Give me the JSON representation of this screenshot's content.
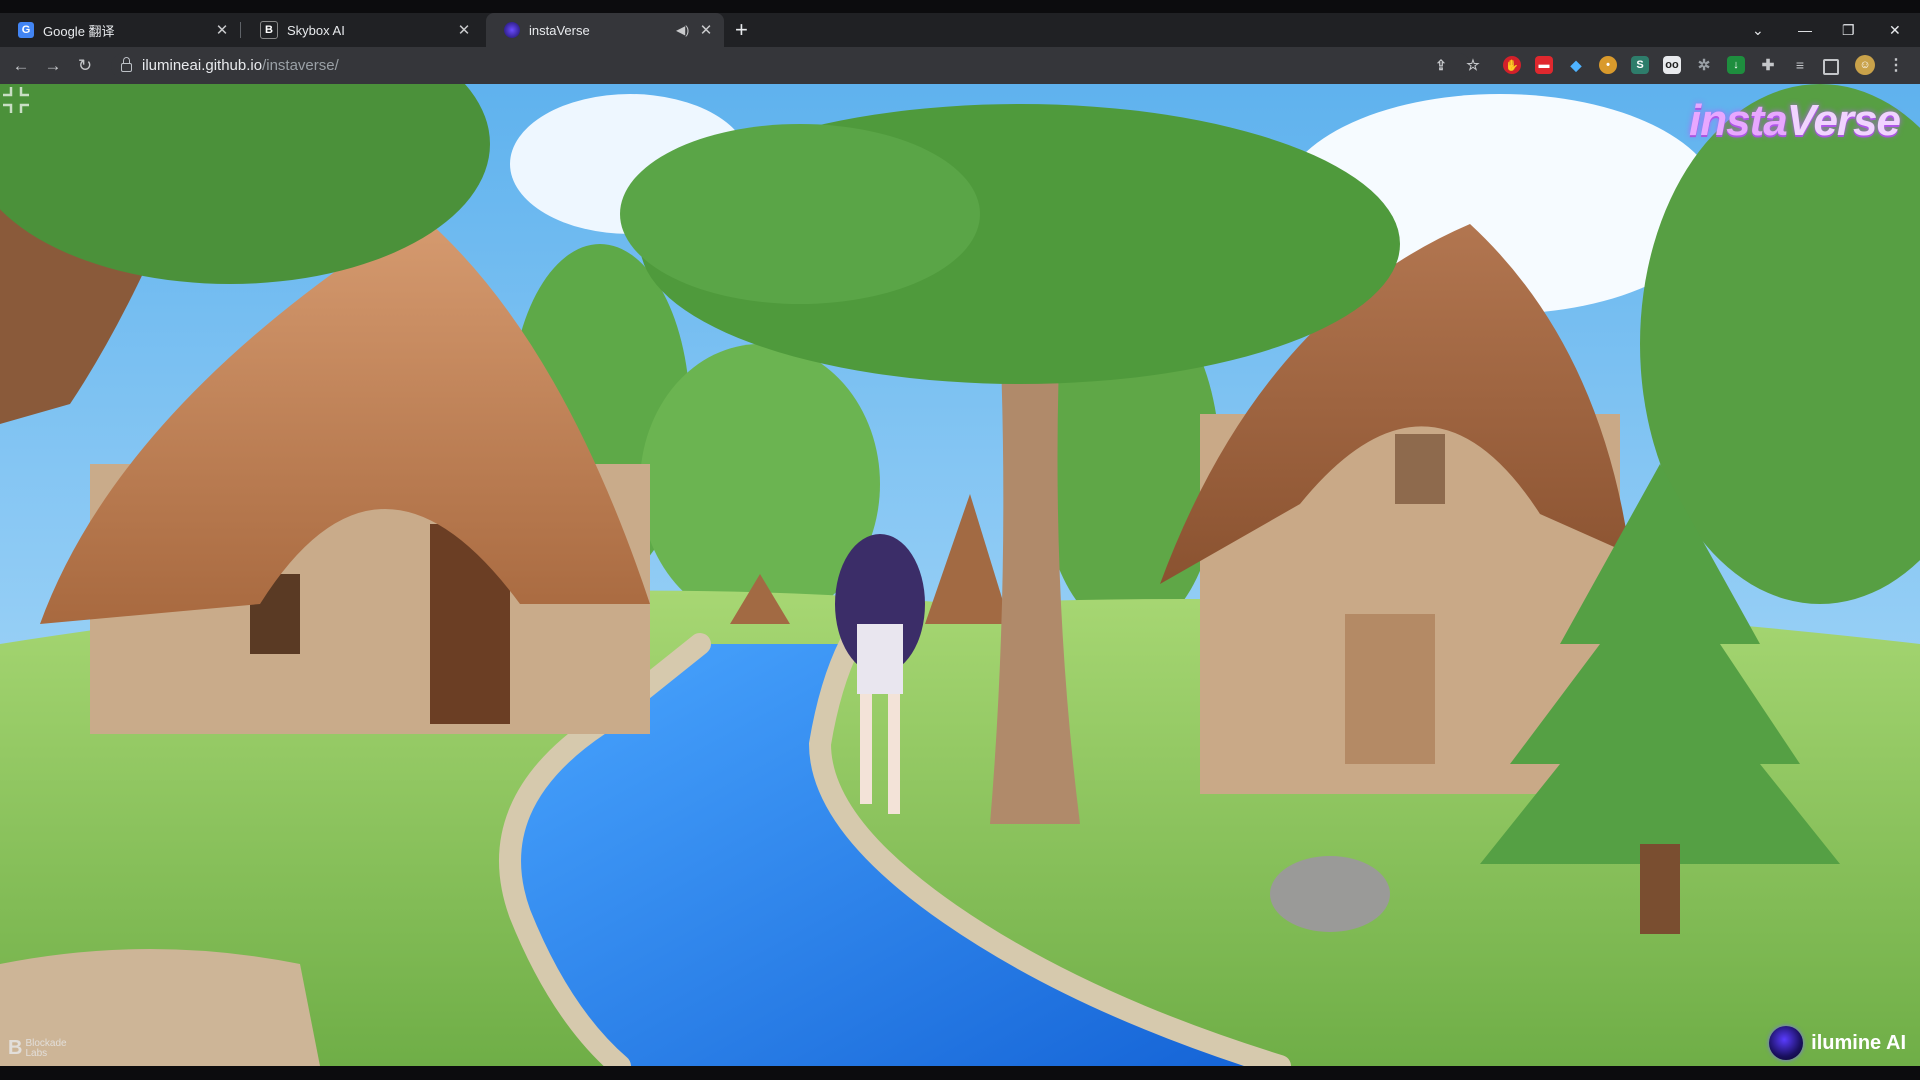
{
  "browser": {
    "tabs": [
      {
        "title": "Google 翻译",
        "favicon": "google-translate-icon",
        "active": false
      },
      {
        "title": "Skybox AI",
        "favicon": "skybox-b-icon",
        "active": false
      },
      {
        "title": "instaVerse",
        "favicon": "instaverse-orb-icon",
        "active": true,
        "audio": true
      }
    ],
    "new_tab_label": "+",
    "url": {
      "host": "ilumineai.github.io",
      "path": "/instaverse/"
    },
    "extensions": [
      "share-icon",
      "bookmark-star-icon",
      "adblock-icon",
      "red-ext-icon",
      "pin-ext-icon",
      "cookie-icon",
      "s-ext-icon",
      "glasses-ext-icon",
      "gear-ext-icon",
      "download-ext-icon",
      "puzzle-icon",
      "media-icon",
      "sidepanel-icon",
      "profile-avatar",
      "more-icon"
    ]
  },
  "app": {
    "brand_prefix": "insta",
    "brand_suffix": "Verse",
    "watermark_line1": "Blockade",
    "watermark_line2": "Labs",
    "company": "ilumine AI",
    "scene": "anime-village-skybox"
  },
  "colors": {
    "chrome_dark": "#202124",
    "chrome_active": "#35363a",
    "sky": "#7cc2ee",
    "grass": "#8ec95e",
    "river": "#2f8ff0",
    "roof": "#c98a5f",
    "brand_glow": "#c86cff"
  }
}
